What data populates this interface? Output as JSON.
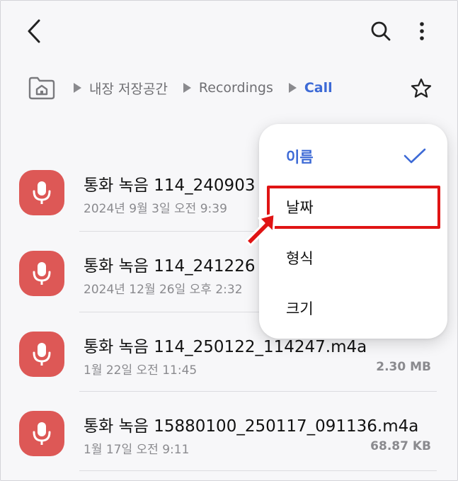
{
  "breadcrumb": {
    "items": [
      {
        "label": "내장 저장공간",
        "active": false
      },
      {
        "label": "Recordings",
        "active": false
      },
      {
        "label": "Call",
        "active": true
      }
    ]
  },
  "files": [
    {
      "name": "통화 녹음 114_240903",
      "date": "2024년 9월 3일 오전 9:39",
      "size": ""
    },
    {
      "name": "통화 녹음 114_241226",
      "date": "2024년 12월 26일 오후 2:32",
      "size": ""
    },
    {
      "name": "통화 녹음 114_250122_114247.m4a",
      "date": "1월 22일 오전 11:45",
      "size": "2.30 MB"
    },
    {
      "name": "통화 녹음 15880100_250117_091136.m4a",
      "date": "1월 17일 오전 9:11",
      "size": "68.87 KB"
    }
  ],
  "sort_menu": {
    "items": [
      {
        "label": "이름",
        "selected": true
      },
      {
        "label": "날짜",
        "selected": false
      },
      {
        "label": "형식",
        "selected": false
      },
      {
        "label": "크기",
        "selected": false
      }
    ]
  },
  "colors": {
    "accent": "#3d6ad6",
    "file_icon": "#dd5856",
    "annotation": "#e01414"
  },
  "icons": {
    "back": "chevron-left-icon",
    "search": "search-icon",
    "more": "more-vertical-icon",
    "home": "home-folder-icon",
    "star": "star-outline-icon",
    "file": "microphone-icon",
    "check": "check-icon"
  }
}
